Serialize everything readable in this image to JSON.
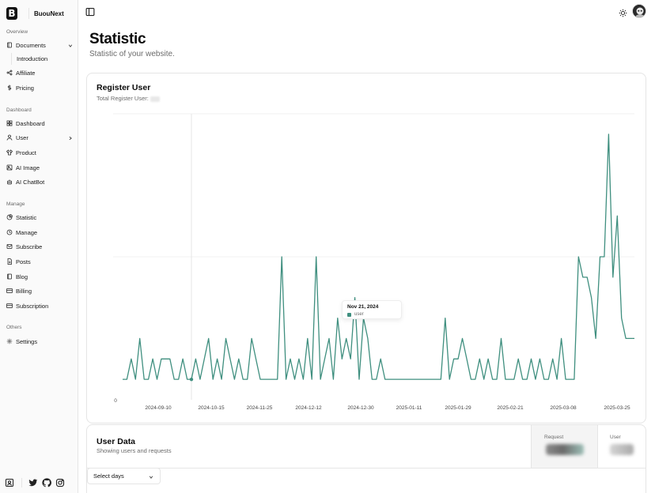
{
  "brand": {
    "logo_letter": "B",
    "name": "BuouNext"
  },
  "sidebar": {
    "sections": [
      {
        "label": "Overview"
      },
      {
        "label": "Dashboard"
      },
      {
        "label": "Manage"
      },
      {
        "label": "Others"
      }
    ],
    "items": {
      "documents": "Documents",
      "introduction": "Introduction",
      "affiliate": "Affiliate",
      "pricing": "Pricing",
      "dashboard": "Dashboard",
      "user": "User",
      "product": "Product",
      "ai_image": "AI Image",
      "ai_chatbot": "AI ChatBot",
      "statistic": "Statistic",
      "manage": "Manage",
      "subscribe": "Subscribe",
      "posts": "Posts",
      "blog": "Blog",
      "billing": "Billing",
      "subscription": "Subscription",
      "settings": "Settings"
    }
  },
  "page": {
    "title": "Statistic",
    "subtitle": "Statistic of your website."
  },
  "register_card": {
    "title": "Register User",
    "subtitle": "Total Register User:"
  },
  "tooltip": {
    "date": "Nov 21, 2024",
    "series": "user"
  },
  "chart_data": {
    "type": "line",
    "x_ticks": [
      "2024-09-10",
      "2024-10-15",
      "2024-11-25",
      "2024-12-12",
      "2024-12-30",
      "2025-01-11",
      "2025-01-29",
      "2025-02-21",
      "2025-03-08",
      "2025-03-25"
    ],
    "y_tick_min": "0",
    "color": "#3f8f7f",
    "grid": true,
    "active_index": 16,
    "series": [
      {
        "name": "user",
        "values": [
          1,
          1,
          2,
          1,
          3,
          1,
          1,
          2,
          1,
          2,
          2,
          2,
          1,
          1,
          2,
          1,
          1,
          2,
          1,
          2,
          3,
          1,
          2,
          1,
          3,
          2,
          1,
          2,
          1,
          1,
          3,
          2,
          1,
          1,
          1,
          1,
          1,
          7,
          1,
          2,
          1,
          2,
          1,
          3,
          1,
          7,
          1,
          2,
          3,
          1,
          4,
          2,
          3,
          2,
          5,
          1,
          4,
          3,
          1,
          1,
          2,
          1,
          1,
          1,
          1,
          1,
          1,
          1,
          1,
          1,
          1,
          1,
          1,
          1,
          1,
          4,
          1,
          2,
          2,
          3,
          2,
          1,
          1,
          2,
          1,
          2,
          1,
          1,
          3,
          1,
          1,
          1,
          2,
          1,
          1,
          2,
          1,
          2,
          1,
          1,
          2,
          1,
          3,
          1,
          1,
          1,
          7,
          6,
          6,
          5,
          3,
          7,
          7,
          13,
          6,
          9,
          4,
          3,
          3,
          3
        ]
      }
    ],
    "ylim": [
      0,
      14
    ]
  },
  "user_data_card": {
    "title": "User Data",
    "subtitle": "Showing users and requests",
    "request_label": "Request",
    "user_label": "User",
    "select_label": "Select days"
  }
}
